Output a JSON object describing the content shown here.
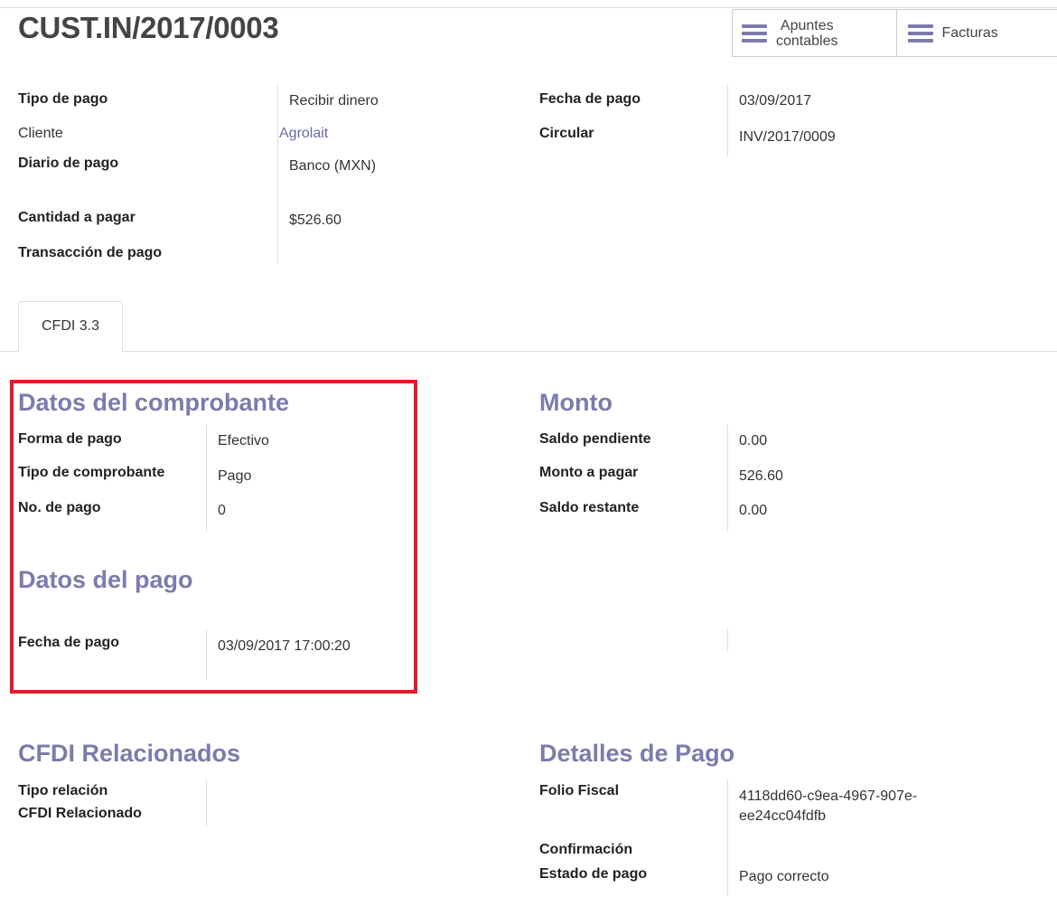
{
  "record_title": "CUST.IN/2017/0003",
  "smart_buttons": {
    "journal_items_line1": "Apuntes",
    "journal_items_line2": "contables",
    "invoices": "Facturas",
    "accent_color": "#7c7bad"
  },
  "main_fields": {
    "payment_type_label": "Tipo de pago",
    "payment_type_value": "Recibir dinero",
    "customer_label": "Cliente",
    "customer_value": "Agrolait",
    "journal_label": "Diario de pago",
    "journal_value": "Banco (MXN)",
    "amount_label": "Cantidad a pagar",
    "amount_value": "$526.60",
    "transaction_label": "Transacción de pago",
    "payment_date_label": "Fecha de pago",
    "payment_date_value": "03/09/2017",
    "memo_label": "Circular",
    "memo_value": "INV/2017/0009"
  },
  "tabs": [
    {
      "label": "CFDI 3.3",
      "active": true
    }
  ],
  "voucher_section": {
    "title": "Datos del comprobante",
    "payment_form_label": "Forma de pago",
    "payment_form_value": "Efectivo",
    "voucher_type_label": "Tipo de comprobante",
    "voucher_type_value": "Pago",
    "payment_number_label": "No. de pago",
    "payment_number_value": "0"
  },
  "amount_section": {
    "title": "Monto",
    "pending_balance_label": "Saldo pendiente",
    "pending_balance_value": "0.00",
    "amount_to_pay_label": "Monto a pagar",
    "amount_to_pay_value": "526.60",
    "remaining_balance_label": "Saldo restante",
    "remaining_balance_value": "0.00"
  },
  "payment_section": {
    "title": "Datos del pago",
    "payment_datetime_label": "Fecha de pago",
    "payment_datetime_value": "03/09/2017 17:00:20"
  },
  "related_section": {
    "title": "CFDI Relacionados",
    "relation_type_label": "Tipo relación",
    "related_cfdi_label": "CFDI Relacionado"
  },
  "details_section": {
    "title": "Detalles de Pago",
    "fiscal_folio_label": "Folio Fiscal",
    "fiscal_folio_line1": "4118dd60-c9ea-4967-907e-",
    "fiscal_folio_line2": "ee24cc04fdfb",
    "confirmation_label": "Confirmación",
    "payment_status_label": "Estado de pago",
    "payment_status_value": "Pago correcto"
  },
  "highlight_color": "#e21b2b"
}
